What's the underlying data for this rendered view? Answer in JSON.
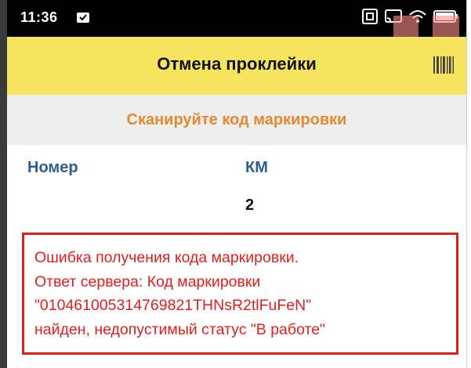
{
  "status_bar": {
    "time": "11:36",
    "icons": [
      "notification-icon",
      "nfc-icon",
      "cast-icon",
      "wifi-icon",
      "battery-icon"
    ],
    "background": "#000000"
  },
  "title_bar": {
    "title": "Отмена проклейки",
    "barcode_button": "barcode-icon",
    "background": "#f7e45e"
  },
  "hint": {
    "text": "Сканируйте код маркировки",
    "color": "#e48a2e"
  },
  "table": {
    "columns": [
      "Номер",
      "КМ"
    ],
    "rows": [
      {
        "number": "",
        "km": "2"
      }
    ],
    "header_color": "#2d5d8f"
  },
  "error": {
    "lines": [
      "Ошибка получения кода маркировки.",
      "Ответ сервера: Код маркировки",
      "\"010461005314769821THNsR2tlFuFeN\"",
      "найден, недопустимый статус \"В работе\""
    ],
    "color": "#e31d1d"
  }
}
